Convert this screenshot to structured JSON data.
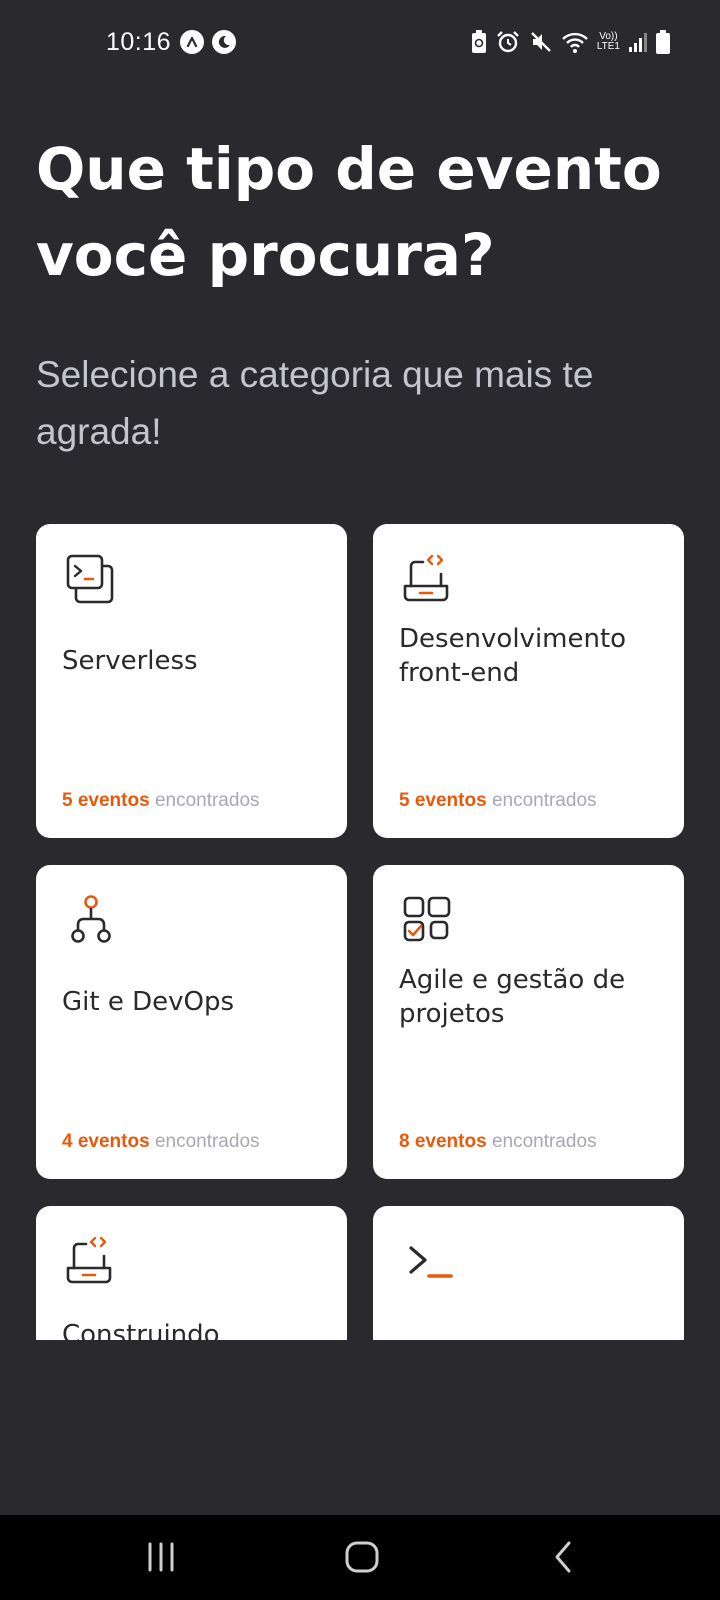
{
  "status_bar": {
    "time": "10:16",
    "network_label_top": "Vo))",
    "network_label_bottom": "LTE1",
    "icons": [
      "navigation-icon",
      "moon-icon",
      "battery-saver-icon",
      "alarm-icon",
      "mute-icon",
      "wifi-icon",
      "signal-icon",
      "battery-icon"
    ]
  },
  "header": {
    "title": "Que tipo de evento você procura?",
    "subtitle": "Selecione a categoria que mais te agrada!"
  },
  "categories": [
    {
      "title": "Serverless",
      "count": "5 eventos",
      "suffix": "encontrados",
      "icon": "terminal-window-icon"
    },
    {
      "title": "Desenvolvimento front-end",
      "count": "5 eventos",
      "suffix": "encontrados",
      "icon": "laptop-code-icon"
    },
    {
      "title": "Git e DevOps",
      "count": "4 eventos",
      "suffix": "encontrados",
      "icon": "git-branch-icon"
    },
    {
      "title": "Agile e gestão de projetos",
      "count": "8 eventos",
      "suffix": "encontrados",
      "icon": "task-grid-icon"
    },
    {
      "title": "Construindo",
      "count": "",
      "suffix": "",
      "icon": "laptop-code-icon"
    },
    {
      "title": "",
      "count": "",
      "suffix": "",
      "icon": "terminal-prompt-icon"
    }
  ],
  "colors": {
    "background": "#29292e",
    "card": "#ffffff",
    "accent": "#e8590c",
    "muted": "#a8a8b3",
    "subtitle": "#c4c4cc"
  },
  "nav_bar": {
    "icons": [
      "recent-apps-icon",
      "home-icon",
      "back-icon"
    ]
  }
}
